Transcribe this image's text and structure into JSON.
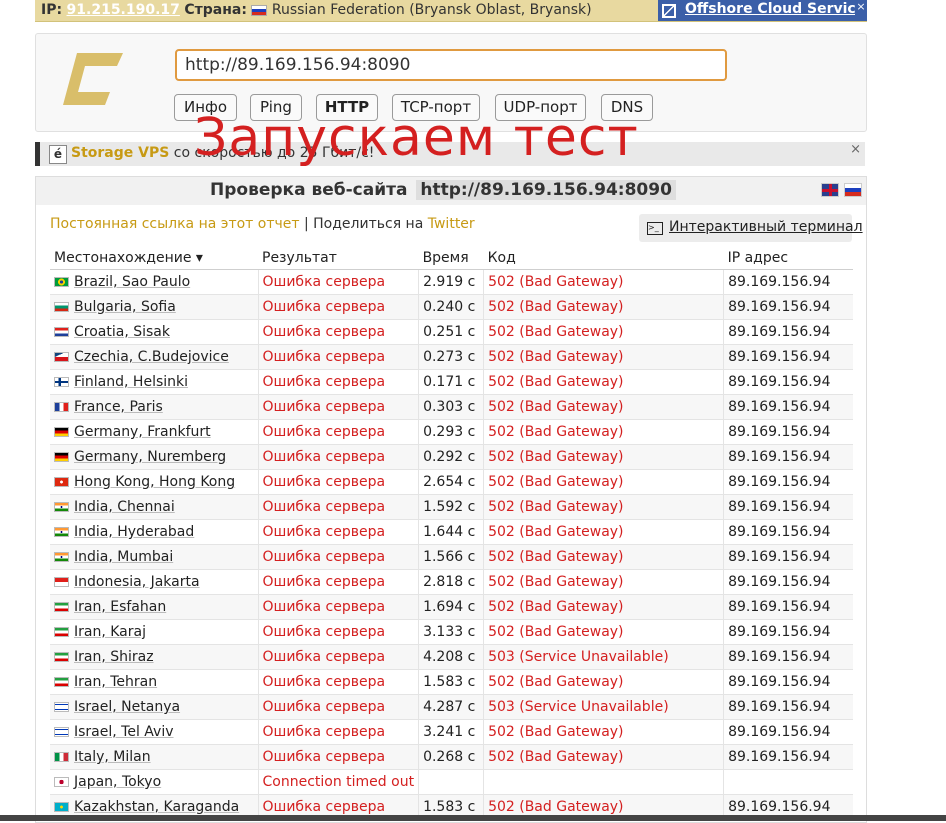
{
  "topbar": {
    "ip_label": "IP:",
    "ip": "91.215.190.17",
    "country_label": "Страна:",
    "country": "Russian Federation (Bryansk Oblast, Bryansk)",
    "offshore": "Offshore Cloud Services",
    "close": "×"
  },
  "search": {
    "url": "http://89.169.156.94:8090",
    "buttons": [
      {
        "label": "Инфо"
      },
      {
        "label": "Ping"
      },
      {
        "label": "HTTP"
      },
      {
        "label": "TCP-порт"
      },
      {
        "label": "UDP-порт"
      },
      {
        "label": "DNS"
      }
    ]
  },
  "overlay_text": "Запускаем тест",
  "vps_banner": {
    "icon": "é",
    "brand": "Storage VPS",
    "text": "со скоростью до 25 Гбит/с!",
    "close": "×"
  },
  "result": {
    "title": "Проверка веб-сайта",
    "url": "http://89.169.156.94:8090",
    "permalink": "Постоянная ссылка на этот отчет",
    "share_prefix": "| Поделиться на",
    "share_twitter": "Twitter",
    "terminal": "Интерактивный терминал",
    "columns": [
      "Местонахождение ▾",
      "Результат",
      "Время",
      "Код",
      "IP адрес"
    ],
    "rows": [
      {
        "flag": "br",
        "location": "Brazil, Sao Paulo",
        "result": "Ошибка сервера",
        "time": "2.919 с",
        "code": "502 (Bad Gateway)",
        "ip": "89.169.156.94"
      },
      {
        "flag": "bg",
        "location": "Bulgaria, Sofia",
        "result": "Ошибка сервера",
        "time": "0.240 с",
        "code": "502 (Bad Gateway)",
        "ip": "89.169.156.94"
      },
      {
        "flag": "hr",
        "location": "Croatia, Sisak",
        "result": "Ошибка сервера",
        "time": "0.251 с",
        "code": "502 (Bad Gateway)",
        "ip": "89.169.156.94"
      },
      {
        "flag": "cz",
        "location": "Czechia, C.Budejovice",
        "result": "Ошибка сервера",
        "time": "0.273 с",
        "code": "502 (Bad Gateway)",
        "ip": "89.169.156.94"
      },
      {
        "flag": "fi",
        "location": "Finland, Helsinki",
        "result": "Ошибка сервера",
        "time": "0.171 с",
        "code": "502 (Bad Gateway)",
        "ip": "89.169.156.94"
      },
      {
        "flag": "fr",
        "location": "France, Paris",
        "result": "Ошибка сервера",
        "time": "0.303 с",
        "code": "502 (Bad Gateway)",
        "ip": "89.169.156.94"
      },
      {
        "flag": "de",
        "location": "Germany, Frankfurt",
        "result": "Ошибка сервера",
        "time": "0.293 с",
        "code": "502 (Bad Gateway)",
        "ip": "89.169.156.94"
      },
      {
        "flag": "de",
        "location": "Germany, Nuremberg",
        "result": "Ошибка сервера",
        "time": "0.292 с",
        "code": "502 (Bad Gateway)",
        "ip": "89.169.156.94"
      },
      {
        "flag": "hk",
        "location": "Hong Kong, Hong Kong",
        "result": "Ошибка сервера",
        "time": "2.654 с",
        "code": "502 (Bad Gateway)",
        "ip": "89.169.156.94"
      },
      {
        "flag": "in",
        "location": "India, Chennai",
        "result": "Ошибка сервера",
        "time": "1.592 с",
        "code": "502 (Bad Gateway)",
        "ip": "89.169.156.94"
      },
      {
        "flag": "in",
        "location": "India, Hyderabad",
        "result": "Ошибка сервера",
        "time": "1.644 с",
        "code": "502 (Bad Gateway)",
        "ip": "89.169.156.94"
      },
      {
        "flag": "in",
        "location": "India, Mumbai",
        "result": "Ошибка сервера",
        "time": "1.566 с",
        "code": "502 (Bad Gateway)",
        "ip": "89.169.156.94"
      },
      {
        "flag": "id",
        "location": "Indonesia, Jakarta",
        "result": "Ошибка сервера",
        "time": "2.818 с",
        "code": "502 (Bad Gateway)",
        "ip": "89.169.156.94"
      },
      {
        "flag": "ir",
        "location": "Iran, Esfahan",
        "result": "Ошибка сервера",
        "time": "1.694 с",
        "code": "502 (Bad Gateway)",
        "ip": "89.169.156.94"
      },
      {
        "flag": "ir",
        "location": "Iran, Karaj",
        "result": "Ошибка сервера",
        "time": "3.133 с",
        "code": "502 (Bad Gateway)",
        "ip": "89.169.156.94"
      },
      {
        "flag": "ir",
        "location": "Iran, Shiraz",
        "result": "Ошибка сервера",
        "time": "4.208 с",
        "code": "503 (Service Unavailable)",
        "ip": "89.169.156.94"
      },
      {
        "flag": "ir",
        "location": "Iran, Tehran",
        "result": "Ошибка сервера",
        "time": "1.583 с",
        "code": "502 (Bad Gateway)",
        "ip": "89.169.156.94"
      },
      {
        "flag": "il",
        "location": "Israel, Netanya",
        "result": "Ошибка сервера",
        "time": "4.287 с",
        "code": "503 (Service Unavailable)",
        "ip": "89.169.156.94"
      },
      {
        "flag": "il",
        "location": "Israel, Tel Aviv",
        "result": "Ошибка сервера",
        "time": "3.241 с",
        "code": "502 (Bad Gateway)",
        "ip": "89.169.156.94"
      },
      {
        "flag": "it",
        "location": "Italy, Milan",
        "result": "Ошибка сервера",
        "time": "0.268 с",
        "code": "502 (Bad Gateway)",
        "ip": "89.169.156.94"
      },
      {
        "flag": "jp",
        "location": "Japan, Tokyo",
        "result": "Connection timed out",
        "time": "",
        "code": "",
        "ip": ""
      },
      {
        "flag": "kz",
        "location": "Kazakhstan, Karaganda",
        "result": "Ошибка сервера",
        "time": "1.583 с",
        "code": "502 (Bad Gateway)",
        "ip": "89.169.156.94"
      }
    ]
  },
  "colors": {
    "accent": "#c79a14",
    "error": "#d42020",
    "input_border": "#e09a40",
    "banner": "#e8d9a0"
  }
}
